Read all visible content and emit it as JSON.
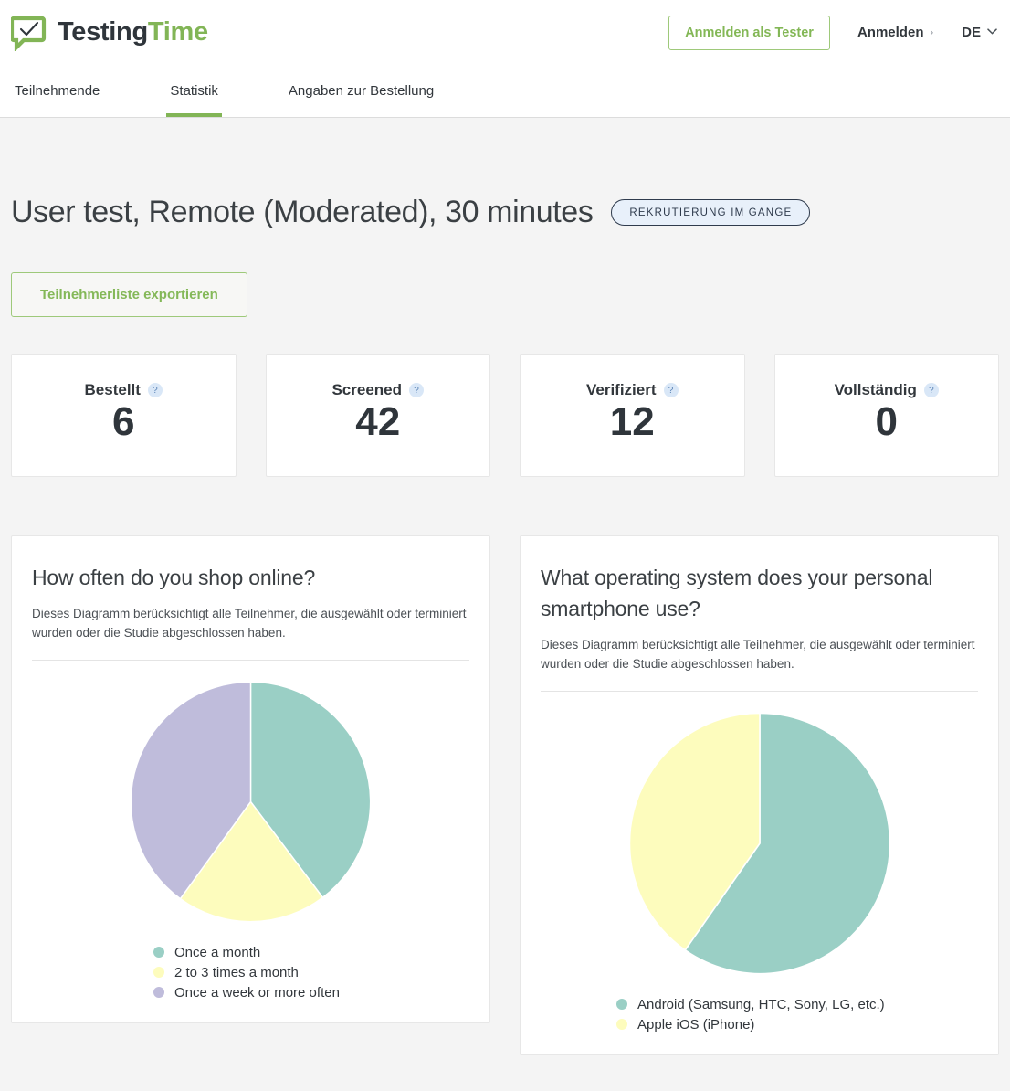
{
  "header": {
    "brand_first": "Testing",
    "brand_second": "Time",
    "logo_icon": "speech-bubble-check-icon",
    "tester_button": "Anmelden als Tester",
    "login_link": "Anmelden",
    "login_chevron": "›",
    "language": "DE",
    "language_caret": "⌄",
    "accent_green": "#82b556",
    "brand_dark": "#2f353b"
  },
  "tabs": [
    {
      "label": "Teilnehmende",
      "active": false
    },
    {
      "label": "Statistik",
      "active": true
    },
    {
      "label": "Angaben zur Bestellung",
      "active": false
    }
  ],
  "main": {
    "page_title": "User test, Remote (Moderated), 30 minutes",
    "status_badge": "REKRUTIERUNG IM GANGE",
    "export_button": "Teilnehmerliste exportieren"
  },
  "stats": [
    {
      "label": "Bestellt",
      "value": "6",
      "help": "?"
    },
    {
      "label": "Screened",
      "value": "42",
      "help": "?"
    },
    {
      "label": "Verifiziert",
      "value": "12",
      "help": "?"
    },
    {
      "label": "Vollständig",
      "value": "0",
      "help": "?"
    }
  ],
  "chart_data": [
    {
      "type": "pie",
      "title": "How often do you shop online?",
      "description": "Dieses Diagramm berücksichtigt alle Teilnehmer, die ausgewählt oder terminiert wurden oder die Studie abgeschlossen haben.",
      "xlabel": "",
      "ylabel": "",
      "legend_position": "bottom-left",
      "grid": false,
      "start_angle": 0,
      "slices": [
        {
          "label": "Once a month",
          "value": 39.7,
          "angle": 143,
          "color": "#9acfc5"
        },
        {
          "label": "2 to 3 times a month",
          "value": 20.3,
          "angle": 73,
          "color": "#fdfcbd"
        },
        {
          "label": "Once a week or more often",
          "value": 40.0,
          "angle": 144,
          "color": "#bfbcdb"
        }
      ]
    },
    {
      "type": "pie",
      "title": "What operating system does your personal smartphone use?",
      "description": "Dieses Diagramm berücksichtigt alle Teilnehmer, die ausgewählt oder terminiert wurden oder die Studie abgeschlossen haben.",
      "xlabel": "",
      "ylabel": "",
      "legend_position": "bottom-left",
      "grid": false,
      "start_angle": 0,
      "slices": [
        {
          "label": "Android (Samsung, HTC, Sony, LG, etc.)",
          "value": 59.7,
          "angle": 215,
          "color": "#9acfc5"
        },
        {
          "label": "Apple iOS (iPhone)",
          "value": 40.3,
          "angle": 145,
          "color": "#fdfcbd"
        }
      ]
    }
  ]
}
